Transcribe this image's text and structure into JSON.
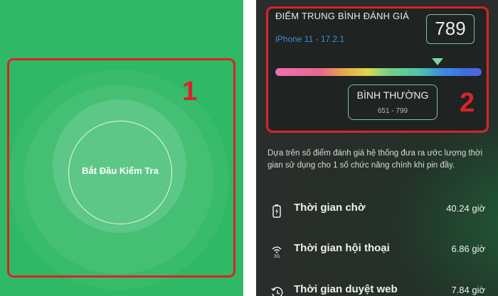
{
  "left_panel": {
    "start_button_label": "Bắt Đầu Kiểm Tra",
    "marker": "1"
  },
  "score_card": {
    "title": "ĐIỂM TRUNG BÌNH ĐÁNH GIÁ",
    "device": "iPhone 11 - 17.2.1",
    "score": "789",
    "status_label": "BÌNH THƯỜNG",
    "status_range": "651 - 799",
    "marker": "2"
  },
  "description": "Dựa trên số điểm đánh giá hệ thống đưa ra ước lượng thời gian sử dụng cho 1 số chức năng chính khi pin đầy.",
  "features": [
    {
      "icon": "battery-charging-icon",
      "name": "Thời gian chờ",
      "value": "40.24 giờ"
    },
    {
      "icon": "3g-signal-icon",
      "name": "Thời gian hội thoại",
      "value": "6.86 giờ"
    },
    {
      "icon": "history-icon",
      "name": "Thời gian duyệt web",
      "value": "7.84 giờ"
    }
  ],
  "colors": {
    "green_background": "#2fb865",
    "highlight_red": "#d9232a",
    "accent_green": "#78c89a",
    "device_blue": "#3d8fd6"
  }
}
